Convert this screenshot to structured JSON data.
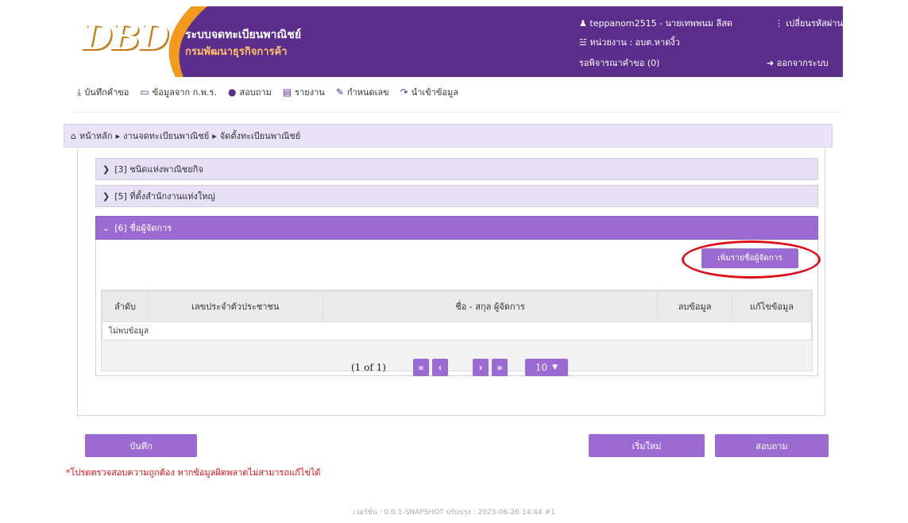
{
  "header": {
    "logo_text": "DBD",
    "brand_title": "ระบบจดทะเบียนพาณิชย์",
    "brand_subtitle": "กรมพัฒนาธุรกิจการค้า",
    "user": "teppanom2515 - นายเทพพนม ลีสด",
    "change_password": "เปลี่ยนรหัสผ่าน",
    "unit": "หน่วยงาน : อบต.หาดงิ้ว",
    "pending": "รอพิจารณาคำขอ (0)",
    "logout": "ออกจากระบบ",
    "brand_color": "#5b2d8c",
    "accent_color": "#f39a1b"
  },
  "menu": [
    {
      "icon": "download-icon",
      "label": "บันทึกคำขอ"
    },
    {
      "icon": "monitor-icon",
      "label": "ข้อมูลจาก ก.พ.ร."
    },
    {
      "icon": "chat-icon",
      "label": "สอบถาม"
    },
    {
      "icon": "document-icon",
      "label": "รายงาน"
    },
    {
      "icon": "edit-icon",
      "label": "กำหนดเลข"
    },
    {
      "icon": "import-icon",
      "label": "นำเข้าข้อมูล"
    }
  ],
  "breadcrumb": {
    "home": "หน้าหลัก",
    "level1": "งานจดทะเบียนพาณิชย์",
    "level2": "จัดตั้งทะเบียนพาณิชย์"
  },
  "sections": [
    {
      "label": "[3] ชนิดแห่งพาณิชยกิจ",
      "expanded": false
    },
    {
      "label": "[5] ที่ตั้งสำนักงานแห่งใหญ่",
      "expanded": false
    },
    {
      "label": "[6] ชื่อผู้จัดการ",
      "expanded": true
    }
  ],
  "add_manager_button": "เพิ่มรายชื่อผู้จัดการ",
  "table": {
    "columns": [
      "ลำดับ",
      "เลขประจำตัวประชาชน",
      "ชื่อ - สกุล ผู้จัดการ",
      "ลบข้อมูล",
      "แก้ไขข้อมูล"
    ],
    "empty_text": "ไม่พบข้อมูล"
  },
  "pagination": {
    "info": "(1 of 1)",
    "first": "«",
    "prev": "‹",
    "next": "›",
    "last": "»",
    "page_size": "10"
  },
  "actions": {
    "save": "บันทึก",
    "reset": "เริ่มใหม่",
    "inquire": "สอบถาม"
  },
  "warning": "*โปรดตรวจสอบความถูกต้อง หากข้อมูลผิดพลาดไม่สามารถแก้ไขได้",
  "footer": "เวอร์ชั่น : 0.0.1-SNAPSHOT ปรับปรุง : 2023-06-26 14:44 #1"
}
